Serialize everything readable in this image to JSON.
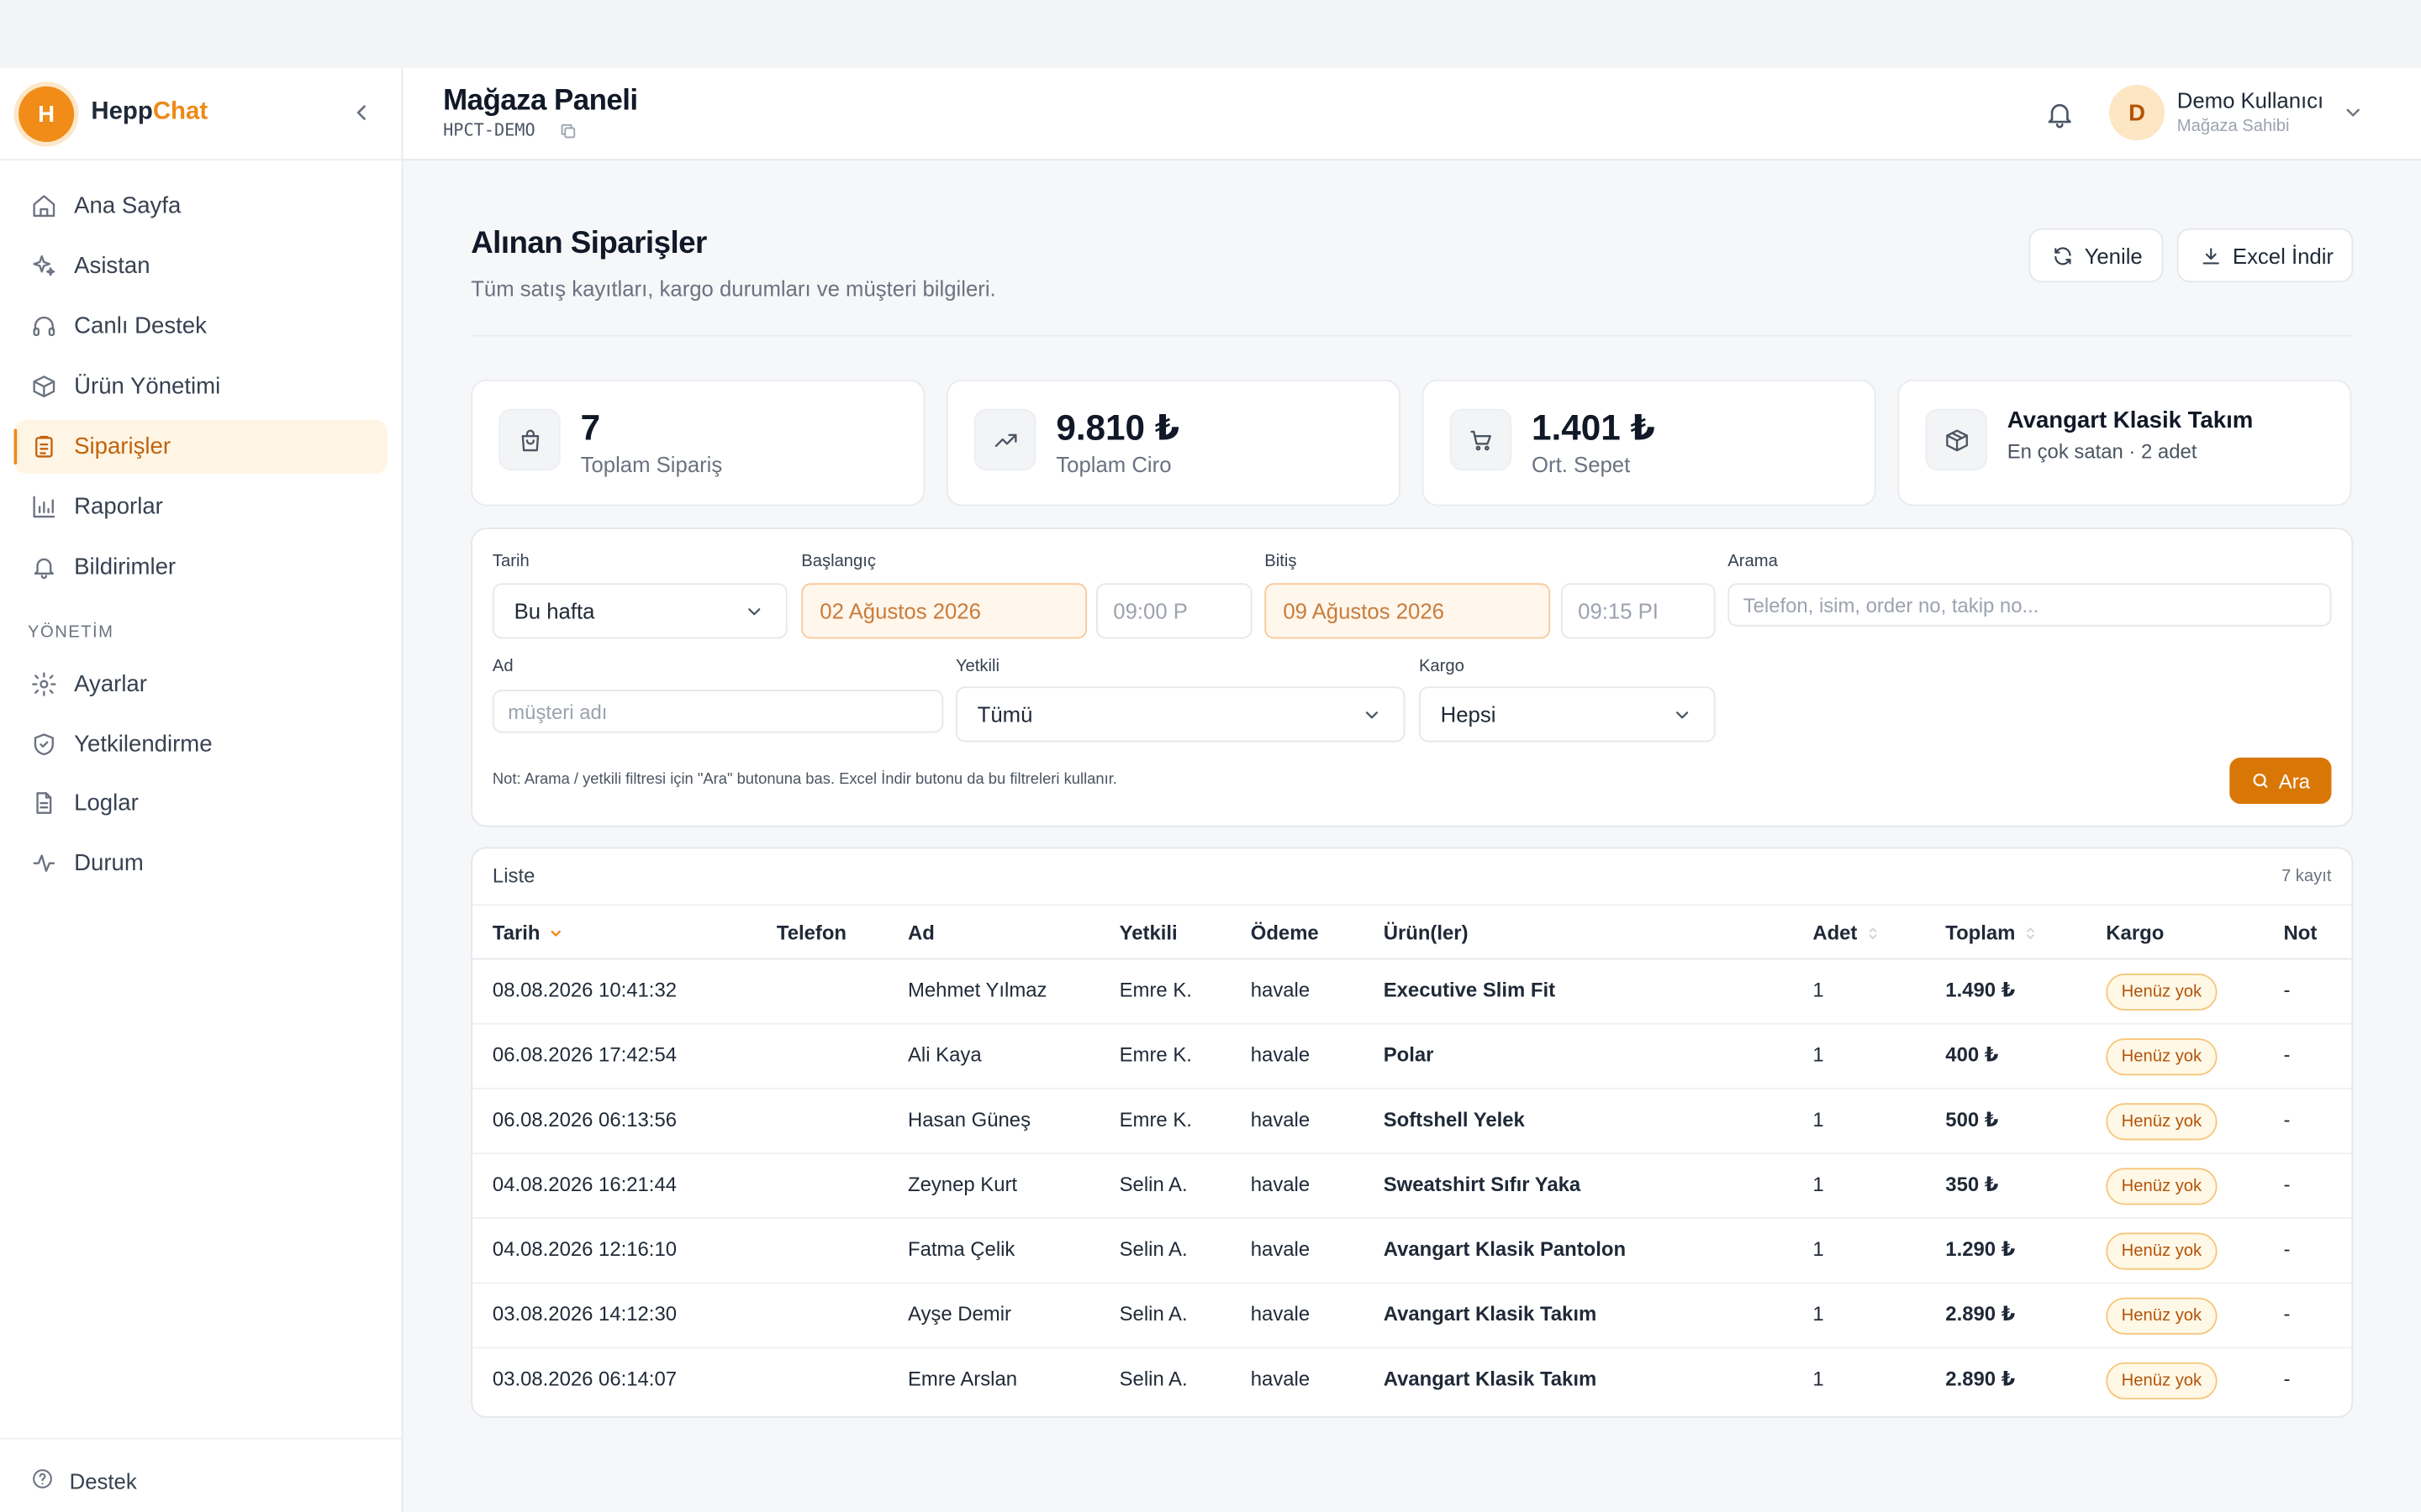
{
  "brand": {
    "logo_letter": "H",
    "name_part1": "Hepp",
    "name_part2": "Chat"
  },
  "sidebar": {
    "items": [
      {
        "label": "Ana Sayfa",
        "icon": "home-icon"
      },
      {
        "label": "Asistan",
        "icon": "sparkles-icon"
      },
      {
        "label": "Canlı Destek",
        "icon": "headphones-icon"
      },
      {
        "label": "Ürün Yönetimi",
        "icon": "box-icon"
      },
      {
        "label": "Siparişler",
        "icon": "clipboard-icon",
        "active": true
      },
      {
        "label": "Raporlar",
        "icon": "bar-chart-icon"
      },
      {
        "label": "Bildirimler",
        "icon": "bell-icon"
      }
    ],
    "section_label": "YÖNETİM",
    "admin_items": [
      {
        "label": "Ayarlar",
        "icon": "gear-icon"
      },
      {
        "label": "Yetkilendirme",
        "icon": "shield-icon"
      },
      {
        "label": "Loglar",
        "icon": "file-icon"
      },
      {
        "label": "Durum",
        "icon": "activity-icon"
      }
    ],
    "footer_label": "Destek"
  },
  "header": {
    "title": "Mağaza Paneli",
    "store_code": "HPCT-DEMO",
    "user": {
      "initial": "D",
      "name": "Demo Kullanıcı",
      "role": "Mağaza Sahibi"
    }
  },
  "main": {
    "title": "Alınan Siparişler",
    "subtitle": "Tüm satış kayıtları, kargo durumları ve müşteri bilgileri.",
    "refresh_label": "Yenile",
    "excel_label": "Excel İndir"
  },
  "stats": [
    {
      "value": "7",
      "label": "Toplam Sipariş",
      "icon": "shopping-bag-icon"
    },
    {
      "value": "9.810 ₺",
      "label": "Toplam Ciro",
      "icon": "trending-up-icon"
    },
    {
      "value": "1.401 ₺",
      "label": "Ort. Sepet",
      "icon": "cart-icon"
    },
    {
      "value": "Avangart Klasik Takım",
      "label": "En çok satan · 2 adet",
      "icon": "package-icon"
    }
  ],
  "filters": {
    "date_label": "Tarih",
    "date_value": "Bu hafta",
    "start_label": "Başlangıç",
    "start_date": "02 Ağustos 2026",
    "start_time": "09:00 P",
    "end_label": "Bitiş",
    "end_date": "09 Ağustos 2026",
    "end_time": "09:15 PI",
    "search_label": "Arama",
    "search_placeholder": "Telefon, isim, order no, takip no...",
    "name_label": "Ad",
    "name_placeholder": "müşteri adı",
    "staff_label": "Yetkili",
    "staff_value": "Tümü",
    "cargo_label": "Kargo",
    "cargo_value": "Hepsi",
    "note": "Not: Arama / yetkili filtresi için \"Ara\" butonuna bas. Excel İndir butonu da bu filtreleri kullanır.",
    "search_button": "Ara"
  },
  "list": {
    "title": "Liste",
    "count": "7 kayıt",
    "columns": [
      "Tarih",
      "Telefon",
      "Ad",
      "Yetkili",
      "Ödeme",
      "Ürün(ler)",
      "Adet",
      "Toplam",
      "Kargo",
      "Not"
    ],
    "rows": [
      {
        "date": "08.08.2026 10:41:32",
        "phone": "",
        "name": "Mehmet Yılmaz",
        "staff": "Emre K.",
        "payment": "havale",
        "product": "Executive Slim Fit",
        "qty": "1",
        "total": "1.490 ₺",
        "cargo": "Henüz yok",
        "note": "-"
      },
      {
        "date": "06.08.2026 17:42:54",
        "phone": "",
        "name": "Ali Kaya",
        "staff": "Emre K.",
        "payment": "havale",
        "product": "Polar",
        "qty": "1",
        "total": "400 ₺",
        "cargo": "Henüz yok",
        "note": "-"
      },
      {
        "date": "06.08.2026 06:13:56",
        "phone": "",
        "name": "Hasan Güneş",
        "staff": "Emre K.",
        "payment": "havale",
        "product": "Softshell Yelek",
        "qty": "1",
        "total": "500 ₺",
        "cargo": "Henüz yok",
        "note": "-"
      },
      {
        "date": "04.08.2026 16:21:44",
        "phone": "",
        "name": "Zeynep Kurt",
        "staff": "Selin A.",
        "payment": "havale",
        "product": "Sweatshirt Sıfır Yaka",
        "qty": "1",
        "total": "350 ₺",
        "cargo": "Henüz yok",
        "note": "-"
      },
      {
        "date": "04.08.2026 12:16:10",
        "phone": "",
        "name": "Fatma Çelik",
        "staff": "Selin A.",
        "payment": "havale",
        "product": "Avangart Klasik Pantolon",
        "qty": "1",
        "total": "1.290 ₺",
        "cargo": "Henüz yok",
        "note": "-"
      },
      {
        "date": "03.08.2026 14:12:30",
        "phone": "",
        "name": "Ayşe Demir",
        "staff": "Selin A.",
        "payment": "havale",
        "product": "Avangart Klasik Takım",
        "qty": "1",
        "total": "2.890 ₺",
        "cargo": "Henüz yok",
        "note": "-"
      },
      {
        "date": "03.08.2026 06:14:07",
        "phone": "",
        "name": "Emre Arslan",
        "staff": "Selin A.",
        "payment": "havale",
        "product": "Avangart Klasik Takım",
        "qty": "1",
        "total": "2.890 ₺",
        "cargo": "Henüz yok",
        "note": "-"
      }
    ]
  },
  "colors": {
    "accent": "#ee8a16",
    "accent_dark": "#d97706",
    "active_bg": "#fff5e5",
    "badge_bg": "#fff8e6"
  }
}
